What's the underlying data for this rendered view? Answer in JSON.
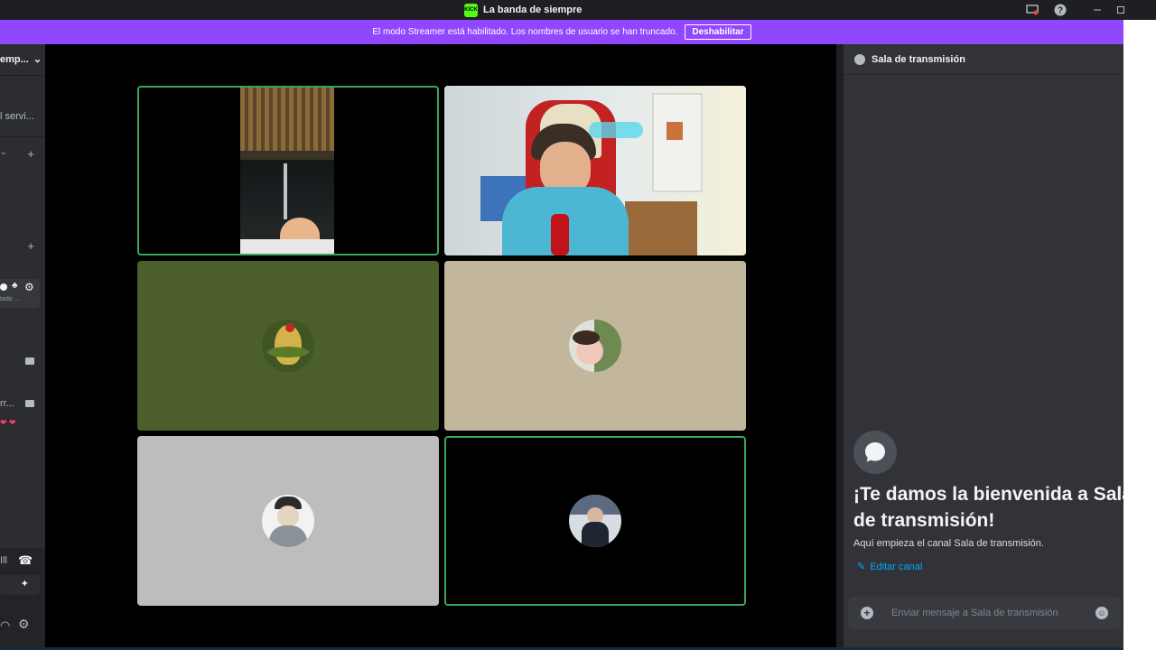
{
  "window": {
    "title": "La banda de siempre",
    "app_logo_text": "KICK"
  },
  "banner": {
    "text": "El modo Streamer está habilitado. Los nombres de usuario se han truncado.",
    "button_label": "Deshabilitar"
  },
  "sidebar": {
    "server_name": "emp...",
    "item_1": "l servi...",
    "user_status": "tado ...",
    "channel_partial": "rr..."
  },
  "call": {
    "tiles": [
      {
        "kind": "video",
        "speaking": true
      },
      {
        "kind": "video",
        "speaking": false
      },
      {
        "kind": "avatar",
        "background": "#4b5e2c",
        "speaking": false
      },
      {
        "kind": "avatar",
        "background": "#c2b69c",
        "speaking": false
      },
      {
        "kind": "avatar",
        "background": "#bdbdbd",
        "speaking": false
      },
      {
        "kind": "avatar",
        "background": "#a9aca6",
        "speaking": true
      }
    ]
  },
  "chat": {
    "channel_name": "Sala de transmisión",
    "welcome_title_line1": "¡Te damos la bienvenida a Sala",
    "welcome_title_line2": "de transmisión!",
    "welcome_desc": "Aquí empieza el canal Sala de transmisión.",
    "edit_channel": "Editar canal",
    "input_placeholder": "Enviar mensaje a Sala de transmisión"
  },
  "colors": {
    "accent": "#9147ff",
    "speaking": "#3ba55c",
    "link": "#00a8fc"
  }
}
